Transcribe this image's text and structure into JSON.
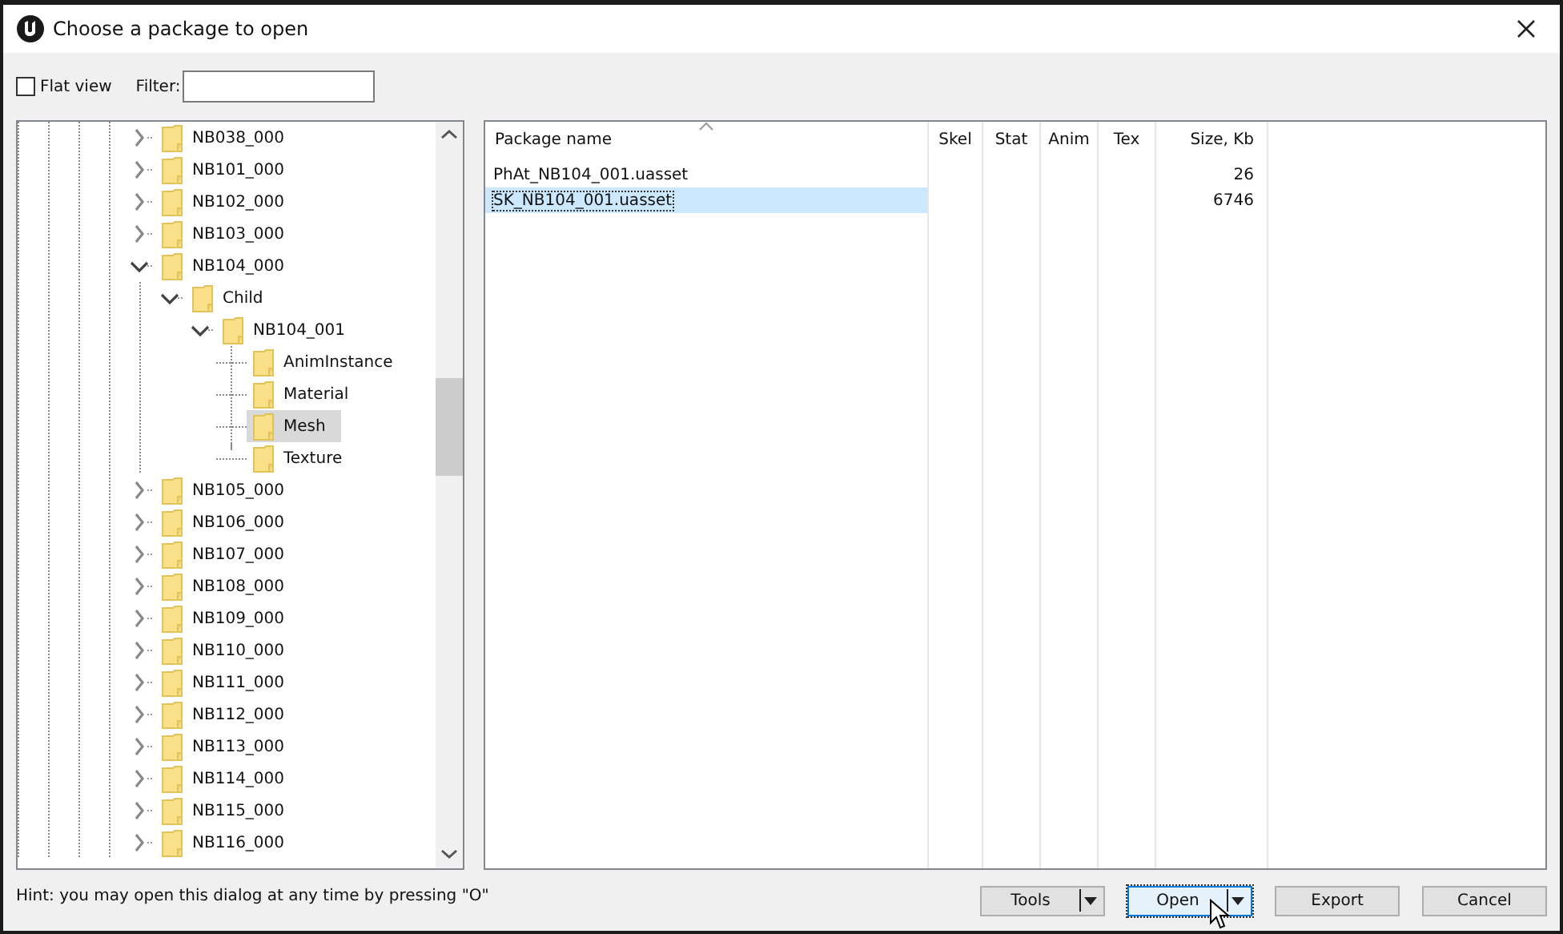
{
  "window": {
    "title": "Choose a package to open"
  },
  "toolbar": {
    "flat_view": {
      "label": "Flat view",
      "checked": false
    },
    "filter": {
      "label": "Filter:"
    }
  },
  "tree": {
    "items": [
      {
        "label": "NB038_000",
        "expanded": false,
        "selected": false
      },
      {
        "label": "NB101_000",
        "expanded": false,
        "selected": false
      },
      {
        "label": "NB102_000",
        "expanded": false,
        "selected": false
      },
      {
        "label": "NB103_000",
        "expanded": false,
        "selected": false
      },
      {
        "label": "NB104_000",
        "expanded": true,
        "selected": false,
        "children": [
          {
            "label": "Child",
            "expanded": true,
            "selected": false,
            "children": [
              {
                "label": "NB104_001",
                "expanded": true,
                "selected": false,
                "children": [
                  {
                    "label": "AnimInstance",
                    "selected": false
                  },
                  {
                    "label": "Material",
                    "selected": false
                  },
                  {
                    "label": "Mesh",
                    "selected": true
                  },
                  {
                    "label": "Texture",
                    "selected": false
                  }
                ]
              }
            ]
          }
        ]
      },
      {
        "label": "NB105_000",
        "expanded": false,
        "selected": false
      },
      {
        "label": "NB106_000",
        "expanded": false,
        "selected": false
      },
      {
        "label": "NB107_000",
        "expanded": false,
        "selected": false
      },
      {
        "label": "NB108_000",
        "expanded": false,
        "selected": false
      },
      {
        "label": "NB109_000",
        "expanded": false,
        "selected": false
      },
      {
        "label": "NB110_000",
        "expanded": false,
        "selected": false
      },
      {
        "label": "NB111_000",
        "expanded": false,
        "selected": false
      },
      {
        "label": "NB112_000",
        "expanded": false,
        "selected": false
      },
      {
        "label": "NB113_000",
        "expanded": false,
        "selected": false
      },
      {
        "label": "NB114_000",
        "expanded": false,
        "selected": false
      },
      {
        "label": "NB115_000",
        "expanded": false,
        "selected": false
      },
      {
        "label": "NB116_000",
        "expanded": false,
        "selected": false
      }
    ]
  },
  "table": {
    "columns": [
      {
        "label": "Package name",
        "kind": "text",
        "sorted": true
      },
      {
        "label": "Skel",
        "kind": "text",
        "sorted": false
      },
      {
        "label": "Stat",
        "kind": "text",
        "sorted": false
      },
      {
        "label": "Anim",
        "kind": "text",
        "sorted": false
      },
      {
        "label": "Tex",
        "kind": "text",
        "sorted": false
      },
      {
        "label": "Size, Kb",
        "kind": "number",
        "sorted": false
      }
    ],
    "rows": [
      {
        "name": "PhAt_NB104_001.uasset",
        "size": "26",
        "selected": false
      },
      {
        "name": "SK_NB104_001.uasset",
        "size": "6746",
        "selected": true
      }
    ]
  },
  "status": {
    "hint": "Hint: you may open this dialog at any time by pressing \"O\""
  },
  "buttons": [
    {
      "label": "Tools",
      "dropdown": true,
      "focused": false
    },
    {
      "label": "Open",
      "dropdown": true,
      "focused": true
    },
    {
      "label": "Export",
      "dropdown": false,
      "focused": false
    },
    {
      "label": "Cancel",
      "dropdown": false,
      "focused": false
    }
  ]
}
